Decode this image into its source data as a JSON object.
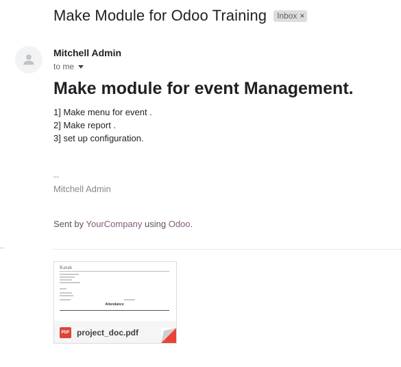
{
  "email": {
    "subject": "Make Module for Odoo Training",
    "label": "Inbox",
    "label_remove": "×",
    "sender": "Mitchell Admin",
    "recipient": "to me",
    "body_heading": "Make module for event Management.",
    "body_lines": [
      "1] Make menu for event .",
      "2] Make report .",
      "3] set up configuration."
    ],
    "signature_dash": "--",
    "signature_name": "Mitchell Admin",
    "sent_by_prefix": "Sent by",
    "sent_by_company": "YourCompany",
    "sent_by_middle": "using",
    "sent_by_app": "Odoo",
    "sent_by_suffix": ".",
    "attachment": {
      "type_badge": "PDF",
      "filename": "project_doc.pdf",
      "preview_logo": "Kanak",
      "preview_title": "Attendance"
    }
  },
  "colors": {
    "link": "#875a7b",
    "pdf_badge": "#db4437",
    "avatar_bg": "#f1f3f4"
  },
  "icons": {
    "avatar": "person-icon",
    "dropdown": "chevron-down-icon",
    "pdf": "pdf-icon"
  }
}
